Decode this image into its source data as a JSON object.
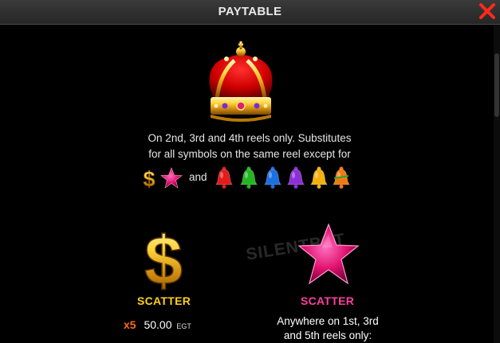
{
  "header": {
    "title": "PAYTABLE",
    "close_icon": "close-x-icon",
    "close_color": "#ff2a1a"
  },
  "wild": {
    "icon": "crown-icon",
    "description_line1": "On 2nd, 3rd and 4th reels only. Substitutes",
    "description_line2": "for all symbols on the same reel except for",
    "and_text": "and",
    "excluded_symbols": [
      "dollar-icon",
      "star-icon"
    ],
    "bells": [
      {
        "icon": "bell-icon",
        "color": "#e21b1b"
      },
      {
        "icon": "bell-icon",
        "color": "#25b523"
      },
      {
        "icon": "bell-icon",
        "color": "#1c6fe0"
      },
      {
        "icon": "bell-icon",
        "color": "#8c2fd8"
      },
      {
        "icon": "bell-icon",
        "color": "#f2b10f"
      },
      {
        "icon": "bell-icon",
        "color": "#f07a12"
      }
    ]
  },
  "scatter_dollar": {
    "icon": "dollar-icon",
    "label": "SCATTER",
    "label_color": "#ffd21a",
    "multiplier": "x5",
    "value": "50.00",
    "currency": "EGT"
  },
  "scatter_star": {
    "icon": "star-icon",
    "label": "SCATTER",
    "label_color": "#ff3fa0",
    "description_line1": "Anywhere on 1st, 3rd",
    "description_line2": "and 5th reels only:"
  },
  "watermark": "SILENTBET"
}
